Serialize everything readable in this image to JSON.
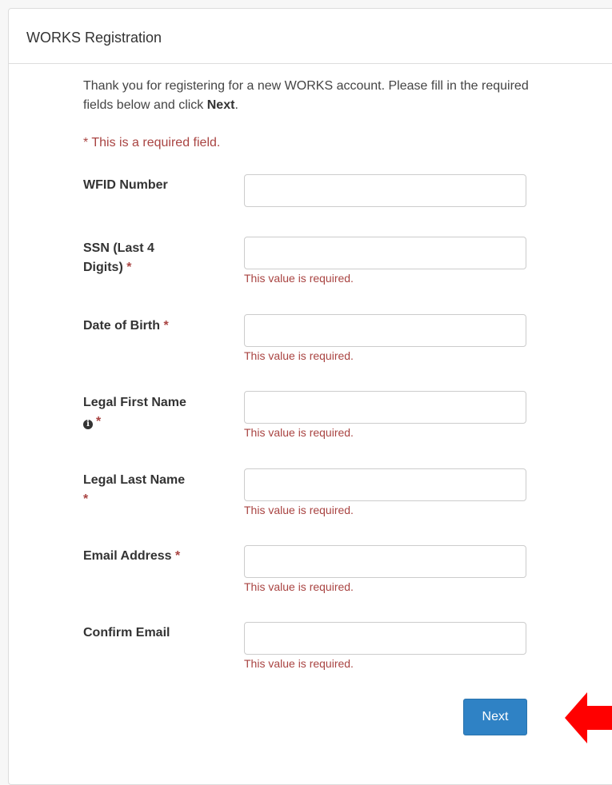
{
  "panel": {
    "title": "WORKS Registration"
  },
  "intro": {
    "text_before": "Thank you for registering for a new WORKS account. Please fill in the required fields below and click ",
    "bold": "Next",
    "text_after": "."
  },
  "required_note": "* This is a required field.",
  "star": "*",
  "fields": [
    {
      "label_line1": "WFID Number",
      "label_line2": "",
      "required": false,
      "error": ""
    },
    {
      "label_line1": "SSN (Last 4",
      "label_line2": "Digits)",
      "required": true,
      "error": "This value is required."
    },
    {
      "label_line1": "Date of Birth",
      "label_line2": "",
      "required": true,
      "error": "This value is required."
    },
    {
      "label_line1": "Legal First Name",
      "label_line2": "",
      "required": true,
      "info_icon": "info-icon",
      "error": "This value is required."
    },
    {
      "label_line1": "Legal Last Name",
      "label_line2": "",
      "required": true,
      "error": "This value is required."
    },
    {
      "label_line1": "Email Address",
      "label_line2": "",
      "required": true,
      "error": "This value is required."
    },
    {
      "label_line1": "Confirm Email",
      "label_line2": "",
      "required": false,
      "error": "This value is required."
    }
  ],
  "next_button": "Next",
  "annotation": {
    "icon": "red-arrow-icon",
    "color": "#ff0000"
  }
}
